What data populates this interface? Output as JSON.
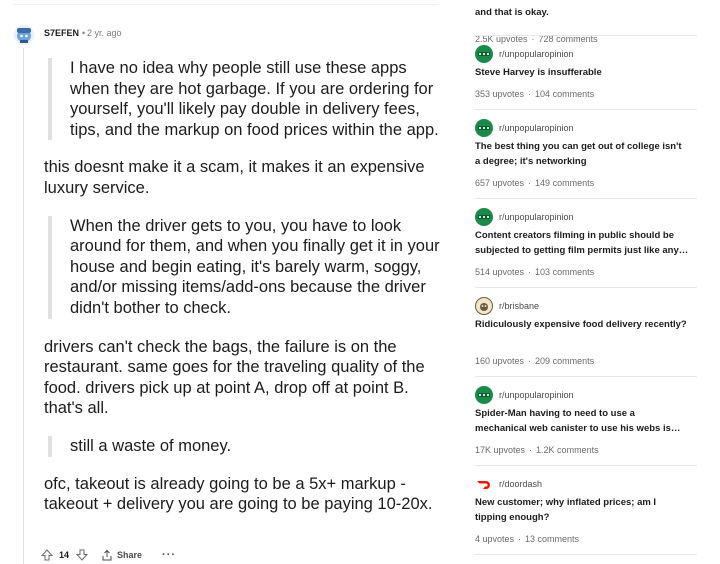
{
  "comment": {
    "author": "S7EFEN",
    "separator": "•",
    "time": "2 yr. ago",
    "quote1": "I have no idea why people still use these apps when they are hot garbage. If you are ordering for yourself, you'll likely pay double in delivery fees, tips, and the markup on food prices within the app.",
    "para1": "this doesnt make it a scam, it makes it an expensive luxury service.",
    "quote2": "When the driver gets to you, you have to look around for them, and when you finally get it in your house and begin eating, it's barely warm, soggy, and/or missing items/add-ons because the driver didn't bother to check.",
    "para2": "drivers can't check the bags, the failure is on the restaurant. same goes for the traveling quality of the food. drivers pick up at point A, drop off at point B. that's all.",
    "quote3": "still a waste of money.",
    "para3": "ofc, takeout is already going to be a 5x+ markup - takeout + delivery you are going to be paying 10-20x.",
    "score": "14",
    "share_label": "Share",
    "more_label": "···"
  },
  "sidebar": {
    "top_fragment": {
      "title": "and that is okay.",
      "upvotes": "2.5K upvotes",
      "comments": "728 comments"
    },
    "posts": [
      {
        "subreddit": "r/unpopularopinion",
        "icon": "unpopularopinion-icon",
        "title": "Steve Harvey is insufferable",
        "upvotes": "353 upvotes",
        "comments": "104 comments"
      },
      {
        "subreddit": "r/unpopularopinion",
        "icon": "unpopularopinion-icon",
        "title": "The best thing you can get out of college isn't a degree; it's networking",
        "upvotes": "657 upvotes",
        "comments": "149 comments"
      },
      {
        "subreddit": "r/unpopularopinion",
        "icon": "unpopularopinion-icon",
        "title": "Content creators filming in public should be subjected to getting film permits just like any other film crew",
        "upvotes": "514 upvotes",
        "comments": "103 comments"
      },
      {
        "subreddit": "r/brisbane",
        "icon": "brisbane-icon",
        "title": "Ridiculously expensive food delivery recently?",
        "upvotes": "160 upvotes",
        "comments": "209 comments"
      },
      {
        "subreddit": "r/unpopularopinion",
        "icon": "unpopularopinion-icon",
        "title": "Spider-Man having to need to use a mechanical web canister to use his webs is better",
        "upvotes": "17K upvotes",
        "comments": "1.2K comments"
      },
      {
        "subreddit": "r/doordash",
        "icon": "doordash-icon",
        "title": "New customer; why inflated prices; am I tipping enough?",
        "upvotes": "4 upvotes",
        "comments": "13 comments"
      }
    ],
    "stat_separator": "·"
  },
  "colors": {
    "unpopularopinion": "#1a8a4a",
    "doordash": "#eb1700",
    "brisbane": "#6b5a3e",
    "avatar": "#6fa4d8"
  }
}
